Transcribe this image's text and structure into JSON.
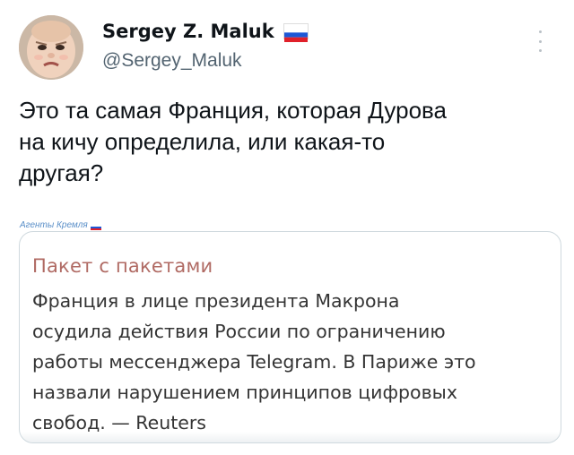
{
  "author": {
    "display_name": "Sergey Z. Maluk",
    "handle": "@Sergey_Maluk",
    "flag_icon": "russia-flag-icon",
    "avatar_icon": "baby-avatar"
  },
  "tweet": {
    "text": "Это та самая Франция, которая Дурова\nна кичу определила, или какая-то\nдругая?"
  },
  "quoted_image": {
    "channel_name": "Агенты Кремля",
    "header": "Пакет с пакетами",
    "body": "Франция в лице президента Макрона\nосудила действия России по ограничению\nработы мессенджера Telegram. В Париже это\nназвали нарушением принципов цифровых\nсвобод. — Reuters"
  },
  "colors": {
    "text_primary": "#0f1419",
    "text_secondary": "#536471",
    "card_header": "#b06a63",
    "channel_link": "#5a8fc8"
  }
}
